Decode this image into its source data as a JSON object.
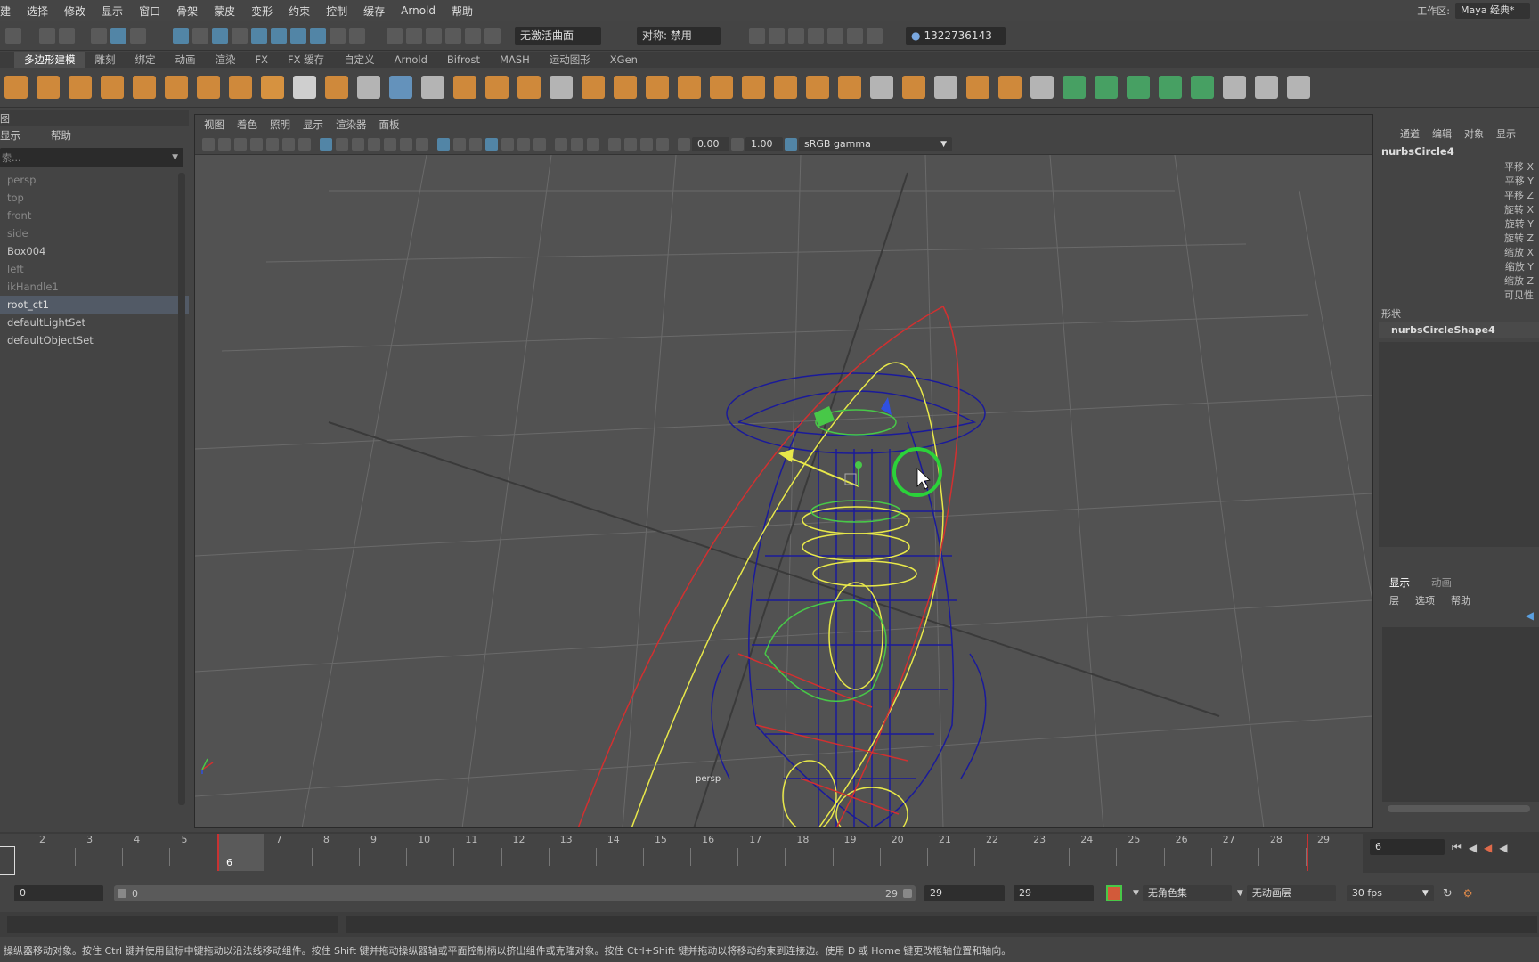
{
  "menubar": {
    "items": [
      "建",
      "选择",
      "修改",
      "显示",
      "窗口",
      "骨架",
      "蒙皮",
      "变形",
      "约束",
      "控制",
      "缓存",
      "Arnold",
      "帮助"
    ],
    "workspace_label": "工作区:",
    "workspace_value": "Maya 经典*"
  },
  "statusline": {
    "live_surface": "无激活曲面",
    "symmetry": "对称: 禁用",
    "user": "1322736143"
  },
  "shelf": {
    "tabs": [
      "多边形建模",
      "雕刻",
      "绑定",
      "动画",
      "渲染",
      "FX",
      "FX 缓存",
      "自定义",
      "Arnold",
      "Bifrost",
      "MASH",
      "运动图形",
      "XGen"
    ],
    "active_tab": "多边形建模",
    "icon_colors": [
      "#e8953a",
      "#e8953a",
      "#e8953a",
      "#e8953a",
      "#e8953a",
      "#e8953a",
      "#e8953a",
      "#e8953a",
      "#f0a040",
      "#e8e8e8",
      "#e8953a",
      "#c8c8c8",
      "#6aa0d0",
      "#c8c8c8",
      "#e8953a",
      "#e8953a",
      "#e8953a",
      "#c8c8c8",
      "#e8953a",
      "#e8953a",
      "#e8953a",
      "#e8953a",
      "#e8953a",
      "#e8953a",
      "#e8953a",
      "#e8953a",
      "#e8953a",
      "#c8c8c8",
      "#e8953a",
      "#c8c8c8",
      "#e8953a",
      "#e8953a",
      "#c8c8c8",
      "#48b068",
      "#48b068",
      "#48b068",
      "#48b068",
      "#48b068",
      "#c8c8c8",
      "#c8c8c8",
      "#c8c8c8"
    ]
  },
  "outliner": {
    "panel_title": "图",
    "menu": [
      "显示",
      "帮助"
    ],
    "search_placeholder": "索...",
    "items": [
      {
        "label": "persp",
        "dim": true
      },
      {
        "label": "top",
        "dim": true
      },
      {
        "label": "front",
        "dim": true
      },
      {
        "label": "side",
        "dim": true
      },
      {
        "label": "Box004",
        "dim": false
      },
      {
        "label": "left",
        "dim": true
      },
      {
        "label": "ikHandle1",
        "dim": true
      },
      {
        "label": "root_ct1",
        "dim": false,
        "selected": true
      },
      {
        "label": "defaultLightSet",
        "dim": false
      },
      {
        "label": "defaultObjectSet",
        "dim": false
      }
    ]
  },
  "viewport": {
    "menu": [
      "视图",
      "着色",
      "照明",
      "显示",
      "渲染器",
      "面板"
    ],
    "exposure": "0.00",
    "gamma": "1.00",
    "colorspace": "sRGB gamma",
    "camera_label": "persp"
  },
  "channelbox": {
    "menu": [
      "通道",
      "编辑",
      "对象",
      "显示"
    ],
    "object": "nurbsCircle4",
    "attributes": [
      "平移 X",
      "平移 Y",
      "平移 Z",
      "旋转 X",
      "旋转 Y",
      "旋转 Z",
      "缩放 X",
      "缩放 Y",
      "缩放 Z",
      "可见性"
    ],
    "shapes_label": "形状",
    "shape_name": "nurbsCircleShape4"
  },
  "layereditor": {
    "tabs": [
      "显示",
      "动画"
    ],
    "menu": [
      "层",
      "选项",
      "帮助"
    ]
  },
  "timeline": {
    "ticks": [
      "2",
      "3",
      "4",
      "5",
      "6",
      "7",
      "8",
      "9",
      "10",
      "11",
      "12",
      "13",
      "14",
      "15",
      "16",
      "17",
      "18",
      "19",
      "20",
      "21",
      "22",
      "23",
      "24",
      "25",
      "26",
      "27",
      "28",
      "29"
    ],
    "current_frame": "6",
    "current_frame_field": "6"
  },
  "range": {
    "start": "0",
    "range_start": "0",
    "range_end": "29",
    "anim_end": "29",
    "anim_end2": "29",
    "character_set": "无角色集",
    "anim_layer": "无动画层",
    "fps": "30 fps"
  },
  "helpline": {
    "text": "操纵器移动对象。按住 Ctrl 键并使用鼠标中键拖动以沿法线移动组件。按住 Shift 键并拖动操纵器轴或平面控制柄以挤出组件或克隆对象。按住 Ctrl+Shift 键并拖动以将移动约束到连接边。使用 D 或 Home 键更改枢轴位置和轴向。"
  }
}
